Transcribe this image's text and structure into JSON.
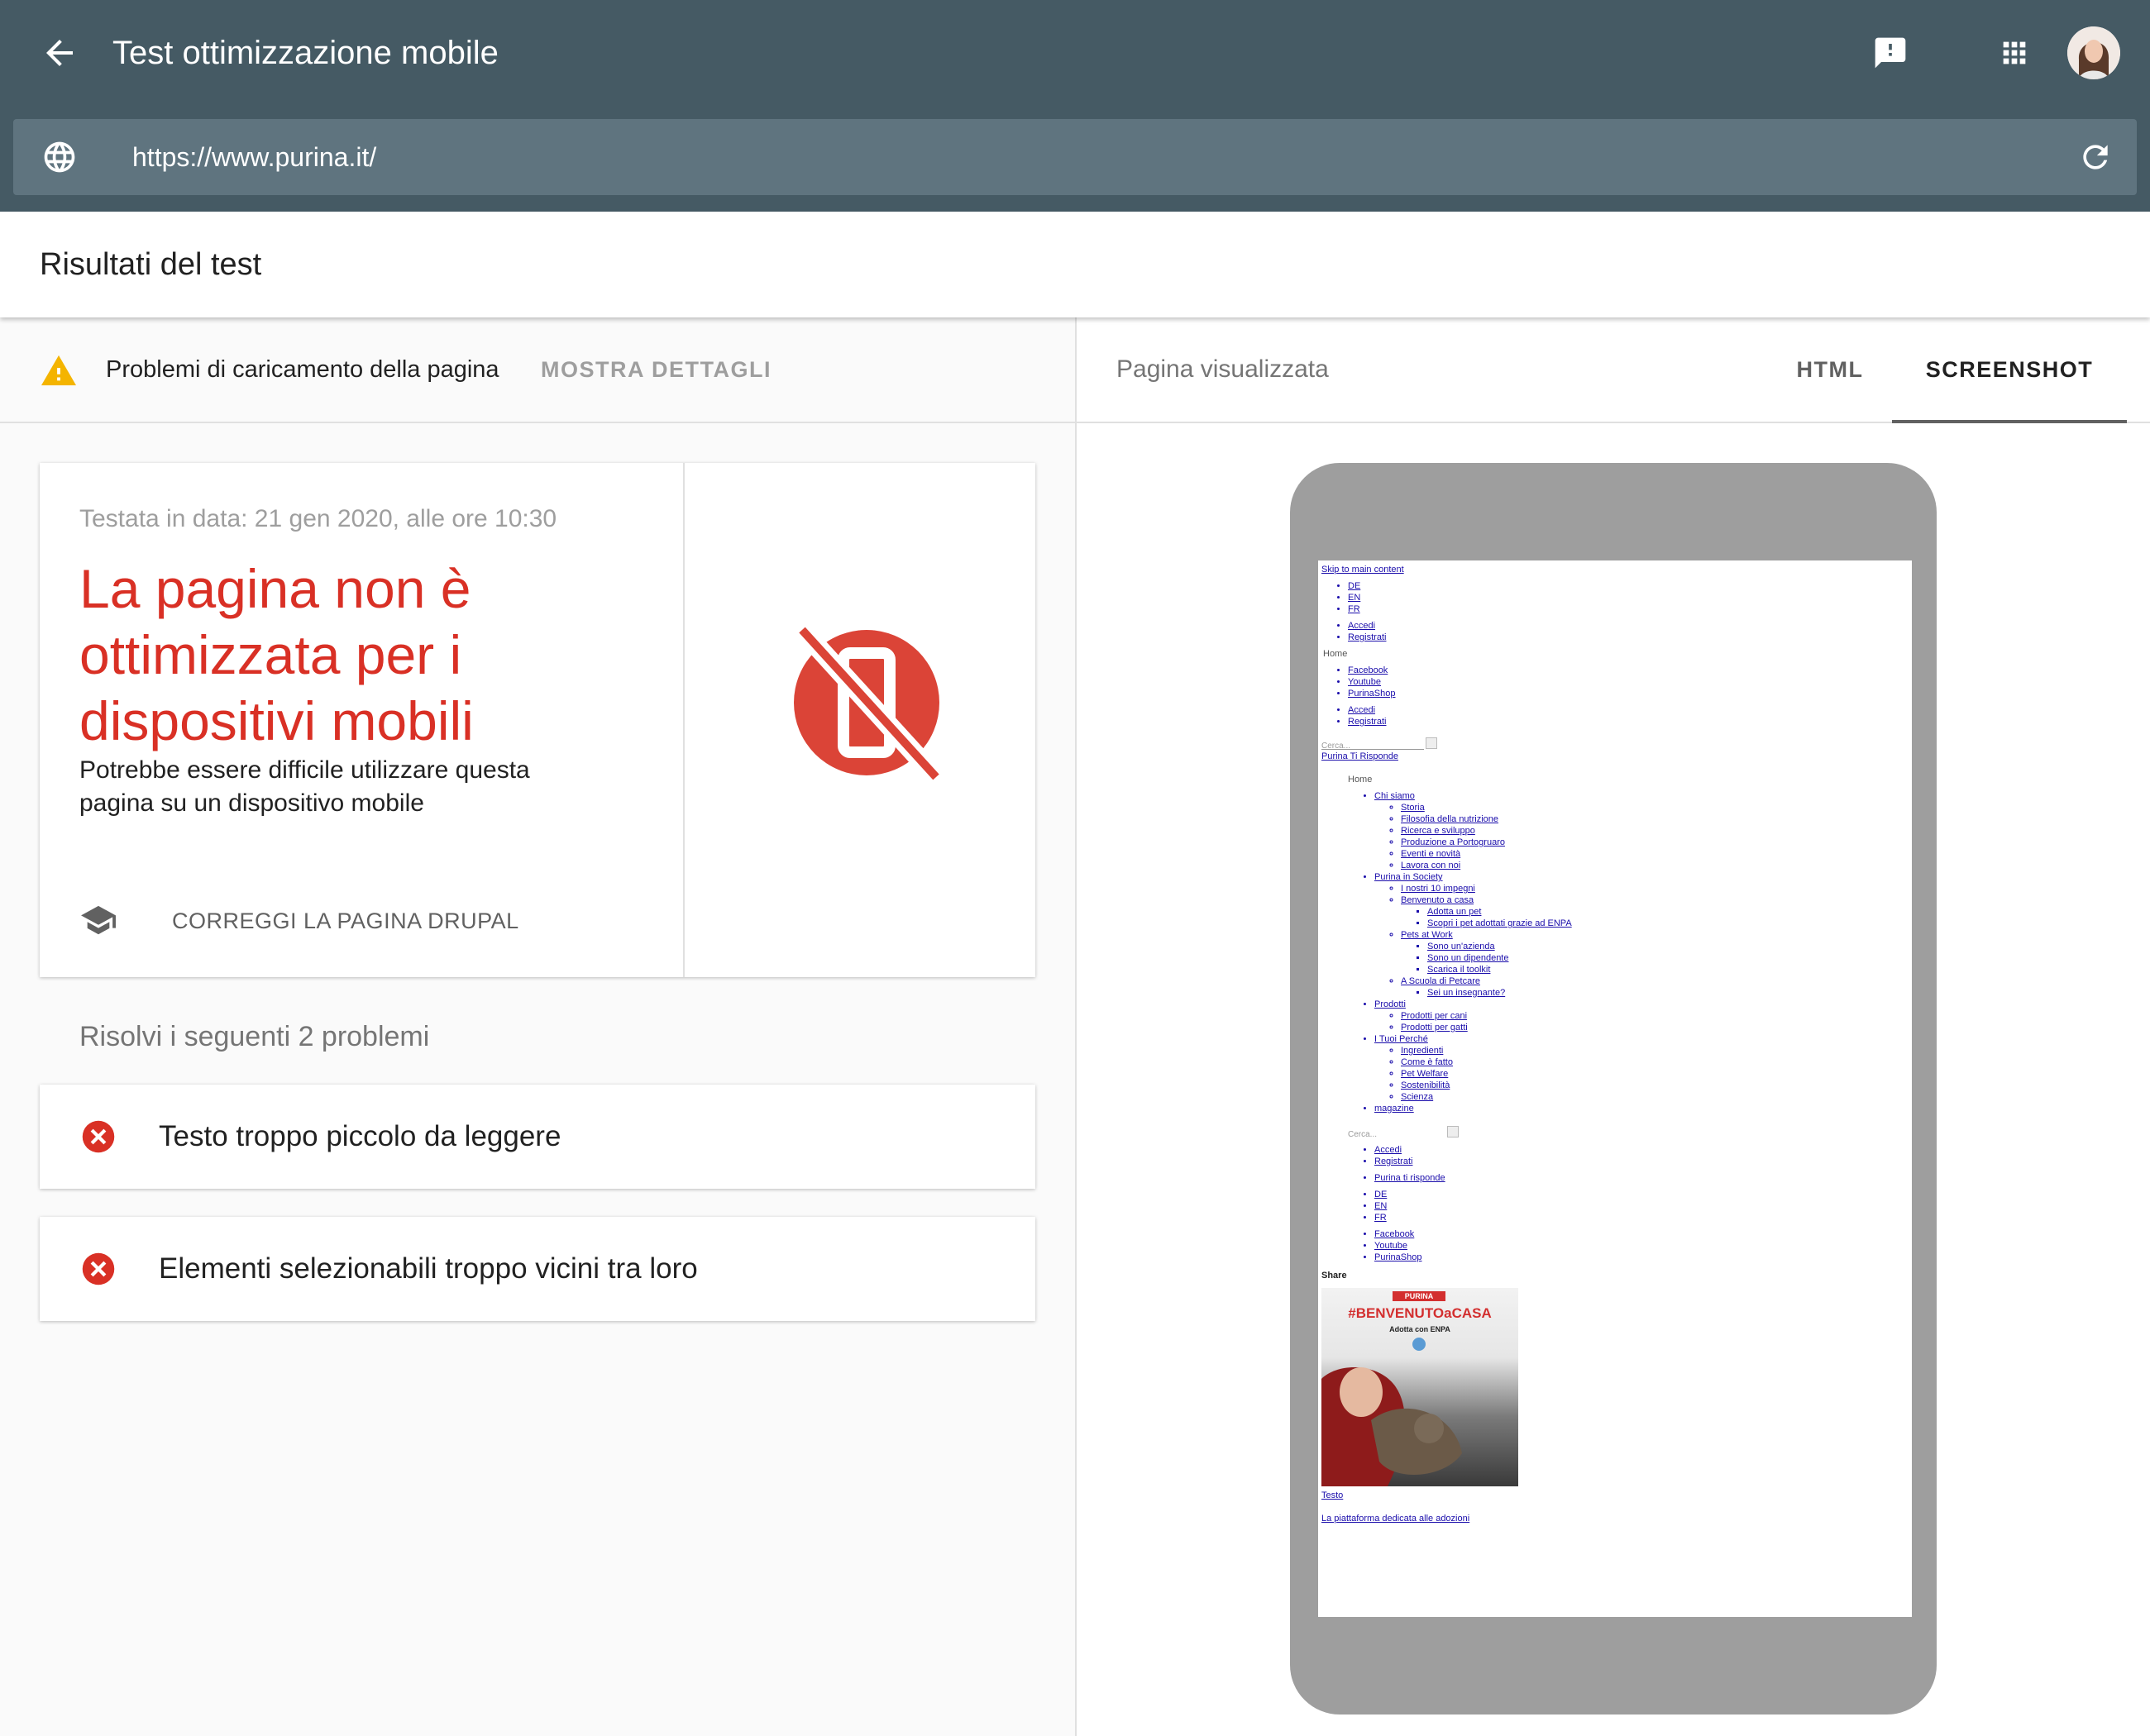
{
  "header": {
    "title": "Test ottimizzazione mobile",
    "url": "https://www.purina.it/"
  },
  "results": {
    "title": "Risultati del test"
  },
  "status": {
    "message": "Problemi di caricamento della pagina",
    "details_link": "MOSTRA DETTAGLI"
  },
  "verdict": {
    "tested_date": "Testata in data: 21 gen 2020, alle ore 10:30",
    "title": "La pagina non è ottimizzata per i dispositivi mobili",
    "description": "Potrebbe essere difficile utilizzare questa pagina su un dispositivo mobile",
    "fix_link": "CORREGGI LA PAGINA DRUPAL"
  },
  "problems": {
    "heading": "Risolvi i seguenti 2 problemi",
    "items": [
      {
        "label": "Testo troppo piccolo da leggere"
      },
      {
        "label": "Elementi selezionabili troppo vicini tra loro"
      }
    ]
  },
  "rendered": {
    "label": "Pagina visualizzata",
    "tabs": [
      {
        "label": "HTML"
      },
      {
        "label": "SCREENSHOT"
      }
    ]
  },
  "screenshot": {
    "skip_link": "Skip to main content",
    "langs": [
      "DE",
      "EN",
      "FR"
    ],
    "account": [
      "Accedi",
      "Registrati"
    ],
    "home_img": "Home",
    "social": [
      "Facebook",
      "Youtube",
      "PurinaShop"
    ],
    "search_placeholder": "Cerca...",
    "ti_risponde": "Purina Ti Risponde",
    "chi_siamo": "Chi siamo",
    "chi_siamo_items": [
      "Storia",
      "Filosofia della nutrizione",
      "Ricerca e sviluppo",
      "Produzione a Portogruaro",
      "Eventi e novità",
      "Lavora con noi"
    ],
    "society": "Purina in Society",
    "society_impegni": "I nostri 10 impegni",
    "benvenuto": "Benvenuto a casa",
    "benvenuto_items": [
      "Adotta un pet",
      "Scopri i pet adottati grazie ad ENPA"
    ],
    "pets_at_work": "Pets at Work",
    "pets_items": [
      "Sono un'azienda",
      "Sono un dipendente",
      "Scarica il toolkit"
    ],
    "scuola": "A Scuola di Petcare",
    "scuola_item": "Sei un insegnante?",
    "prodotti": "Prodotti",
    "prodotti_items": [
      "Prodotti per cani",
      "Prodotti per gatti"
    ],
    "perche": "I Tuoi Perché",
    "perche_items": [
      "Ingredienti",
      "Come è fatto",
      "Pet Welfare",
      "Sostenibilità",
      "Scienza"
    ],
    "magazine": "magazine",
    "ti_risponde_2": "Purina ti risponde",
    "share": "Share",
    "promo_brand": "PURINA",
    "promo_title": "#BENVENUTOaCASA",
    "promo_sub": "Adotta con ENPA",
    "testo": "Testo",
    "footer_link": "La piattaforma dedicata alle adozioni"
  },
  "colors": {
    "header_bg": "#455a64",
    "urlbar_bg": "#5f747f",
    "error_red": "#d93025",
    "warning_yellow": "#f4b400"
  }
}
